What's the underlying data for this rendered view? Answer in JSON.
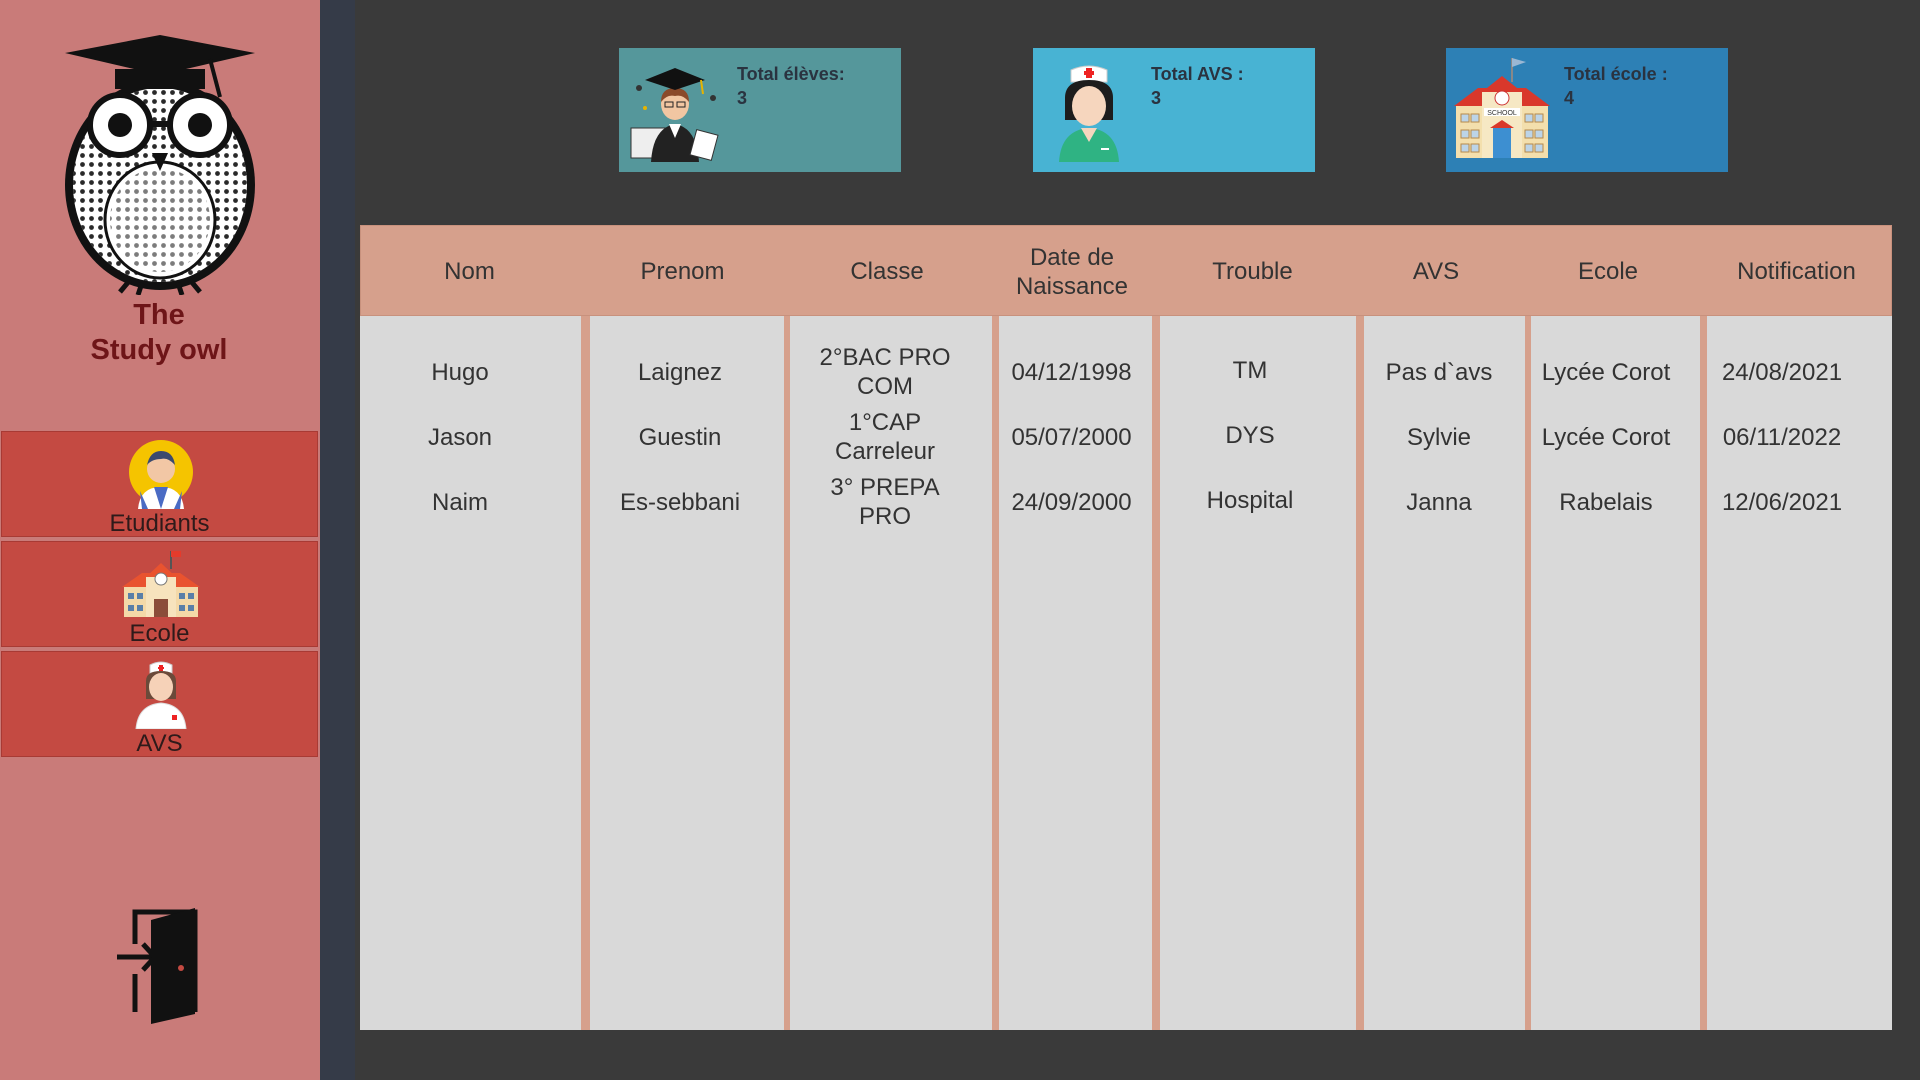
{
  "app": {
    "title": "The\nStudy owl"
  },
  "nav": [
    {
      "label": "Etudiants",
      "icon": "student-icon"
    },
    {
      "label": "Ecole",
      "icon": "school-icon"
    },
    {
      "label": "AVS",
      "icon": "nurse-icon"
    }
  ],
  "exit": {
    "icon": "exit-door-icon"
  },
  "cards": [
    {
      "label": "Total élèves:",
      "value": "3",
      "icon": "graduate-icon",
      "color": "#55979b"
    },
    {
      "label": "Total AVS :",
      "value": "3",
      "icon": "nurse-icon",
      "color": "#48b3d3"
    },
    {
      "label": "Total école :",
      "value": "4",
      "icon": "school-building-icon",
      "color": "#2d80b5"
    }
  ],
  "table": {
    "headers": [
      "Nom",
      "Prenom",
      "Classe",
      "Date de\nNaissance",
      "Trouble",
      "AVS",
      "Ecole",
      "Notification"
    ],
    "rows": [
      [
        "Hugo",
        "Laignez",
        "2°BAC PRO\nCOM",
        "04/12/1998",
        "TM",
        "Pas d`avs",
        "Lycée Corot",
        "24/08/2021"
      ],
      [
        "Jason",
        "Guestin",
        "1°CAP\nCarreleur",
        "05/07/2000",
        "DYS",
        "Sylvie",
        "Lycée Corot",
        "06/11/2022"
      ],
      [
        "Naim",
        "Es-sebbani",
        "3° PREPA\nPRO",
        "24/09/2000",
        "Hospital",
        "Janna",
        "Rabelais",
        "12/06/2021"
      ]
    ]
  },
  "colors": {
    "sidebar": "#c97b79",
    "nav_button": "#c44a42",
    "table_header": "#d6a08c",
    "table_body": "#d9d9d9",
    "background": "#3a3a3a"
  }
}
